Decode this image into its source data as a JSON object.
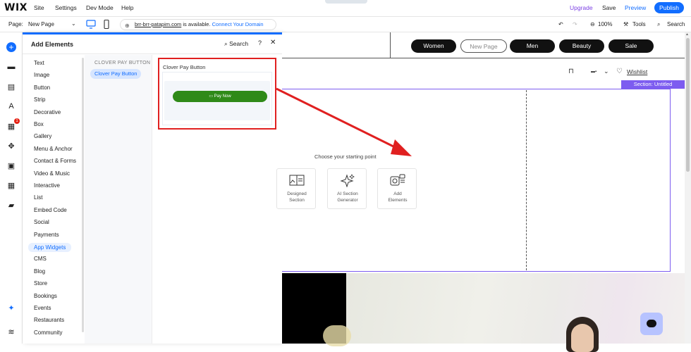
{
  "topbar": {
    "logo": "WIX",
    "menu": [
      "Site",
      "Settings",
      "Dev Mode",
      "Help"
    ],
    "upgrade": "Upgrade",
    "save": "Save",
    "preview": "Preview",
    "publish": "Publish"
  },
  "bar2": {
    "page_label": "Page:",
    "page_value": "New Page",
    "domain": "brr-brr-patapim.com",
    "domain_status": " is available. ",
    "connect": "Connect Your Domain",
    "zoom": "100%",
    "tools": "Tools",
    "search": "Search"
  },
  "panel": {
    "title": "Add Elements",
    "search": "Search",
    "help": "?",
    "close": "✕",
    "categories": [
      "Text",
      "Image",
      "Button",
      "Strip",
      "Decorative",
      "Box",
      "Gallery",
      "Menu & Anchor",
      "Contact & Forms",
      "Video & Music",
      "Interactive",
      "List",
      "Embed Code",
      "Social",
      "Payments",
      "App Widgets",
      "CMS",
      "Blog",
      "Store",
      "Bookings",
      "Events",
      "Restaurants",
      "Community"
    ],
    "active_category": "App Widgets",
    "sub_header": "CLOVER PAY BUTTON",
    "sub_item": "Clover Pay Button",
    "card_title": "Clover Pay Button",
    "pay_button": "Pay Now"
  },
  "rail": {
    "apps_badge": "1"
  },
  "canvas": {
    "nav": [
      "Women",
      "New Page",
      "Men",
      "Beauty",
      "Sale"
    ],
    "wishlist": "Wishlist",
    "section_tag": "Section: Untitled",
    "start_text": "Choose your starting point",
    "options": [
      {
        "label": "Designed\nSection"
      },
      {
        "label": "AI Section\nGenerator"
      },
      {
        "label": "Add\nElements"
      }
    ]
  },
  "colors": {
    "accent": "#116dff",
    "section": "#7d5cf0",
    "annotation": "#e02020",
    "pay_button": "#2f8a18"
  }
}
